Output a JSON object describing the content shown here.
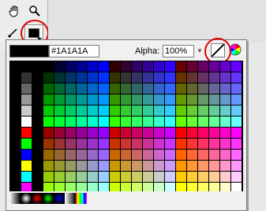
{
  "tools": {
    "hand": "hand-icon",
    "zoom": "zoom-icon",
    "pen": "pen-icon",
    "fill": "fill-color-icon"
  },
  "colors": {
    "current_fill": "#000000",
    "circle": "#e00000",
    "panel_bg": "#f0f0f0",
    "grid_bg": "#000000"
  },
  "picker": {
    "hex_value": "#1A1A1A",
    "alpha_label": "Alpha:",
    "alpha_value": "100%",
    "no_color_icon": "no-color-icon",
    "color_wheel_icon": "color-wheel-icon"
  },
  "palette": {
    "left_column_grays": [
      "#000000",
      "#333333",
      "#666666",
      "#999999",
      "#cccccc",
      "#ffffff"
    ],
    "left_column_basics": [
      "#ff0000",
      "#00ff00",
      "#0000ff",
      "#ffff00",
      "#00ffff",
      "#ff00ff"
    ],
    "gradients": [
      "#000000",
      "#ffffff",
      "#ff0000",
      "#00ff00",
      "#0000ff",
      "rainbow"
    ]
  }
}
